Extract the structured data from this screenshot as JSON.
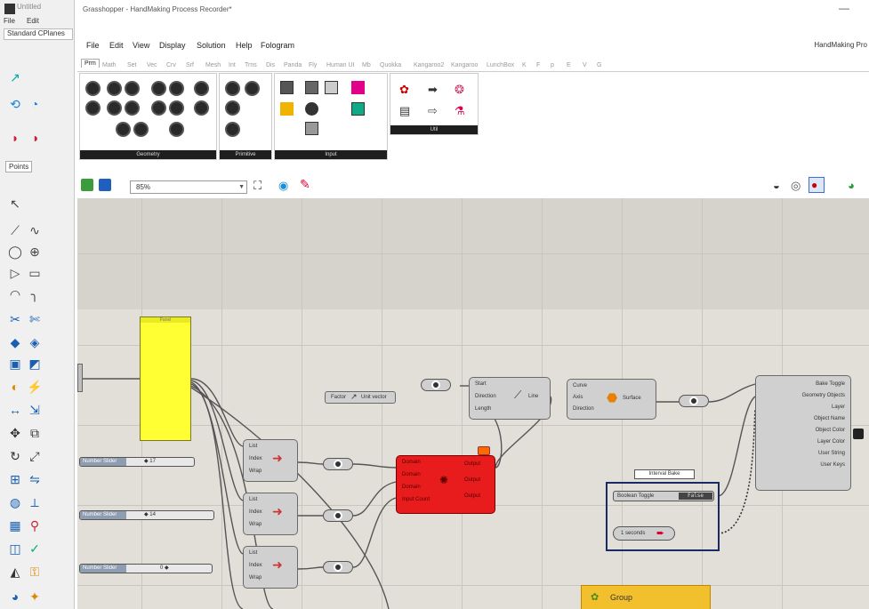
{
  "rhino": {
    "title": "Untitled",
    "menu": [
      "File",
      "Edit"
    ],
    "tab": "Standard CPlanes",
    "points_label": "Points"
  },
  "gh": {
    "title": "Grasshopper - HandMaking Process Recorder*",
    "menu": [
      "File",
      "Edit",
      "View",
      "Display",
      "Solution",
      "Help",
      "Fologram"
    ],
    "doc_name": "HandMaking Pro",
    "tabs": [
      "Prm",
      "Math",
      "Set",
      "Vec",
      "Crv",
      "Srf",
      "Mesh",
      "Int",
      "Trns",
      "Dis",
      "Panda",
      "Fly",
      "Human UI",
      "Mb",
      "Quokka",
      "Kangaroo2",
      "Kangaroo",
      "LunchBox",
      "K",
      "F",
      "p",
      "E",
      "V",
      "G"
    ],
    "ribbon_groups": [
      "Geometry",
      "Primitive",
      "Input",
      "Util"
    ],
    "zoom": "85%"
  },
  "canvas": {
    "panel_text": "Panel",
    "factor_label": "Factor",
    "unit_vector_label": "Unit vector",
    "line_inputs": [
      "Start",
      "Direction",
      "Length"
    ],
    "line_label": "Line",
    "extrude_inputs": [
      "Curve",
      "Axis",
      "Direction"
    ],
    "extrude_label": "Surface",
    "red_inputs": [
      "Domain",
      "Domain",
      "Domain",
      "Input Count"
    ],
    "red_outputs": [
      "Output",
      "Output",
      "Output"
    ],
    "list_inputs": [
      "List",
      "Index",
      "Wrap"
    ],
    "slider_label": "Number Slider",
    "slider_values": [
      "◆ 17",
      "◆ 14",
      "0 ◆"
    ],
    "bake_outputs": [
      "Bake Toggle",
      "Geometry Objects",
      "Layer",
      "Object Name",
      "Object Color",
      "Layer Color",
      "User String",
      "User Keys"
    ],
    "interval_bake_label": "Interval Bake",
    "boolean_toggle_label": "Boolean Toggle",
    "boolean_toggle_value": "False",
    "timer_label": "1 seconds",
    "group_label": "Group"
  }
}
